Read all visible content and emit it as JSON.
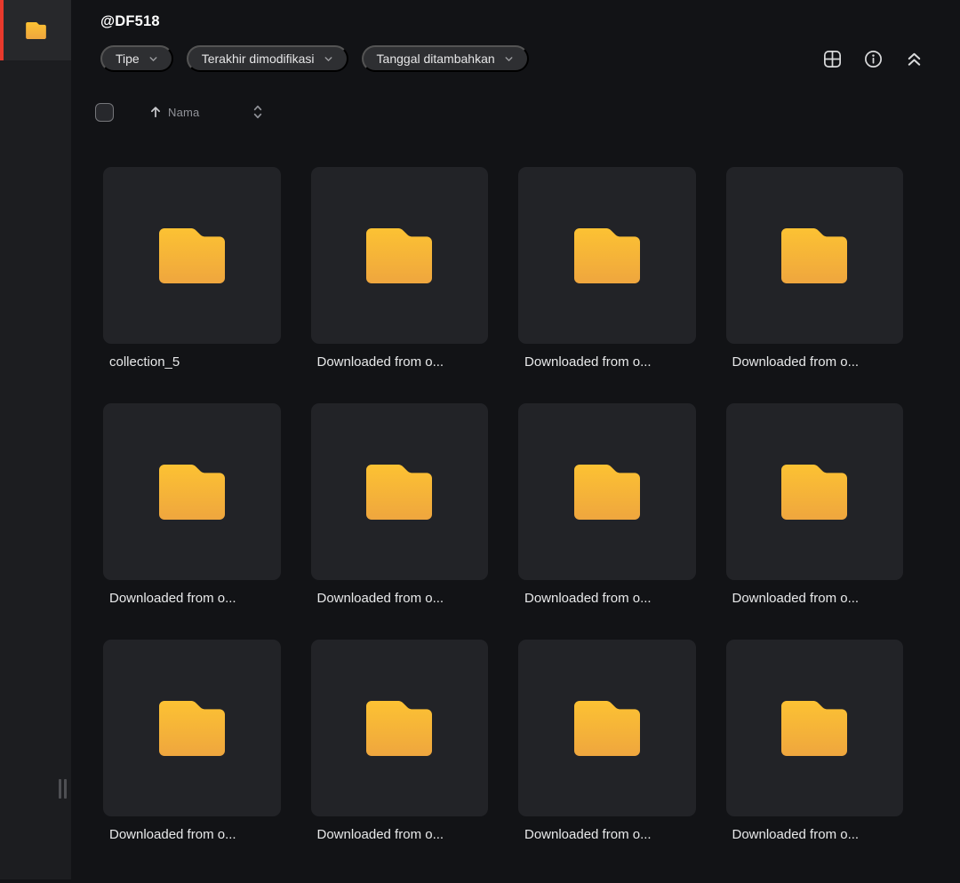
{
  "header": {
    "title": "@DF518"
  },
  "sidebar": {
    "active_item": {
      "icon": "folder-icon",
      "accent_color": "#E8392C"
    }
  },
  "filters": {
    "type": {
      "label": "Tipe"
    },
    "modified": {
      "label": "Terakhir dimodifikasi"
    },
    "added": {
      "label": "Tanggal ditambahkan"
    }
  },
  "toolbar": {
    "icons": [
      "grid-view-icon",
      "info-icon",
      "collapse-up-icon"
    ]
  },
  "list_header": {
    "sort_field": "Nama",
    "sort_direction": "ascending"
  },
  "files": {
    "items": [
      {
        "name": "collection_5",
        "type": "folder"
      },
      {
        "name": "Downloaded from o...",
        "type": "folder"
      },
      {
        "name": "Downloaded from o...",
        "type": "folder"
      },
      {
        "name": "Downloaded from o...",
        "type": "folder"
      },
      {
        "name": "Downloaded from o...",
        "type": "folder"
      },
      {
        "name": "Downloaded from o...",
        "type": "folder"
      },
      {
        "name": "Downloaded from o...",
        "type": "folder"
      },
      {
        "name": "Downloaded from o...",
        "type": "folder"
      },
      {
        "name": "Downloaded from o...",
        "type": "folder"
      },
      {
        "name": "Downloaded from o...",
        "type": "folder"
      },
      {
        "name": "Downloaded from o...",
        "type": "folder"
      },
      {
        "name": "Downloaded from o...",
        "type": "folder"
      }
    ]
  },
  "colors": {
    "background": "#121316",
    "sidebar": "#1C1D20",
    "card": "#222327",
    "chip": "#2E2F32",
    "accent_red": "#E8392C",
    "folder_gradient_top": "#FCC233",
    "folder_gradient_bottom": "#EFA63E"
  }
}
